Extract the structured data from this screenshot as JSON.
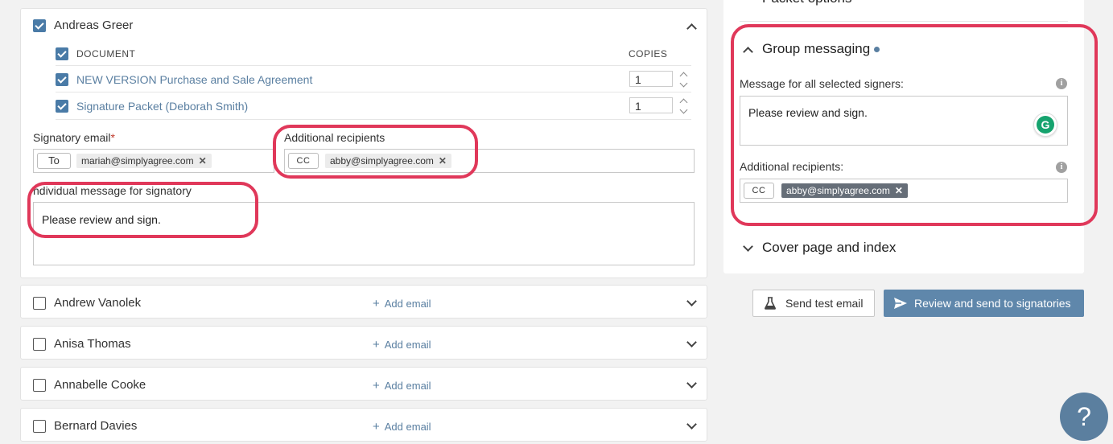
{
  "signer": {
    "name": "Andreas Greer",
    "doc_header": "DOCUMENT",
    "copies_header": "COPIES",
    "documents": [
      {
        "name": "NEW VERSION Purchase and Sale Agreement",
        "copies": "1"
      },
      {
        "name": "Signature Packet (Deborah Smith)",
        "copies": "1"
      }
    ],
    "signatory_email_label": "Signatory email",
    "required_mark": "*",
    "to_label": "To",
    "to_email": "mariah@simplyagree.com",
    "additional_label": "Additional recipients",
    "cc_label": "CC",
    "cc_email": "abby@simplyagree.com",
    "individual_msg_label": "ndividual message for signatory",
    "individual_msg": "Please review and sign."
  },
  "other_signers": [
    {
      "name": "Andrew Vanolek",
      "add": "Add email"
    },
    {
      "name": "Anisa Thomas",
      "add": "Add email"
    },
    {
      "name": "Annabelle Cooke",
      "add": "Add email"
    },
    {
      "name": "Bernard Davies",
      "add": "Add email"
    }
  ],
  "sidebar": {
    "packet_options": "Packet options",
    "group_messaging": "Group messaging",
    "msg_all_label": "Message for all selected signers:",
    "msg_all": "Please review and sign.",
    "grammarly": "G",
    "additional_label": "Additional recipients:",
    "cc_label": "CC",
    "cc_email": "abby@simplyagree.com",
    "cover_page": "Cover page and index"
  },
  "buttons": {
    "send_test": "Send test email",
    "review_send": "Review and send to signatories"
  },
  "help": "?",
  "close_glyph": "✕",
  "plus_glyph": "+",
  "info_glyph": "i",
  "colors": {
    "accent": "#5a7fa1",
    "highlight": "#e0385a",
    "primary_button": "#5f87ab"
  }
}
